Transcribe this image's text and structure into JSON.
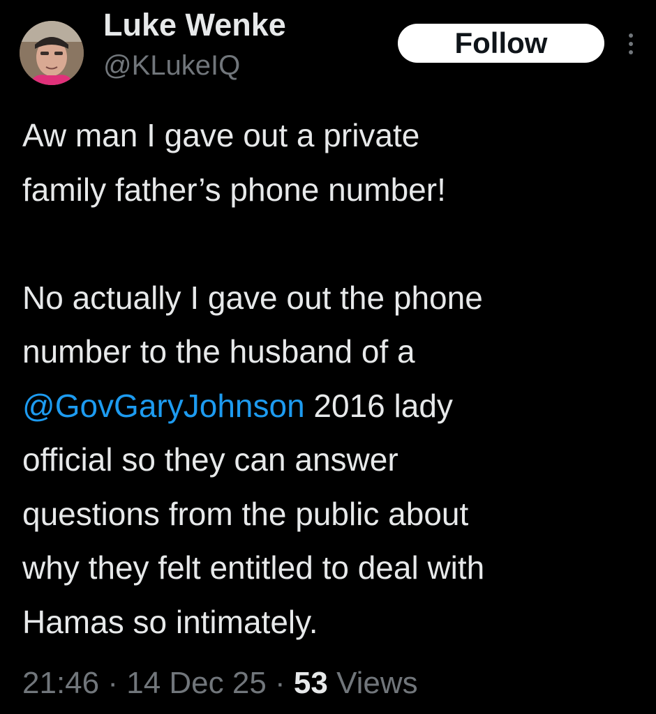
{
  "author": {
    "name": "Luke Wenke",
    "handle": "@KLukeIQ"
  },
  "follow_label": "Follow",
  "tweet": {
    "line1": "Aw man I gave out a private",
    "line2": "family father’s phone number!",
    "line3": "No actually I gave out the phone",
    "line4": "number to the husband of a",
    "mention": "@GovGaryJohnson",
    "line5_rest": " 2016 lady",
    "line6": "official so they can answer",
    "line7": "questions from the public about",
    "line8": "why they felt entitled to deal with",
    "line9": "Hamas so intimately."
  },
  "meta": {
    "time": "21:46",
    "sep1": " · ",
    "date": "14 Dec 25",
    "sep2": " · ",
    "views_count": "53",
    "views_label": " Views"
  },
  "colors": {
    "background": "#000000",
    "text": "#e7e9ea",
    "secondary": "#71767b",
    "link": "#1d9bf0",
    "button_bg": "#ffffff"
  },
  "icons": {
    "avatar": "profile-photo",
    "more": "more-vertical-icon"
  }
}
